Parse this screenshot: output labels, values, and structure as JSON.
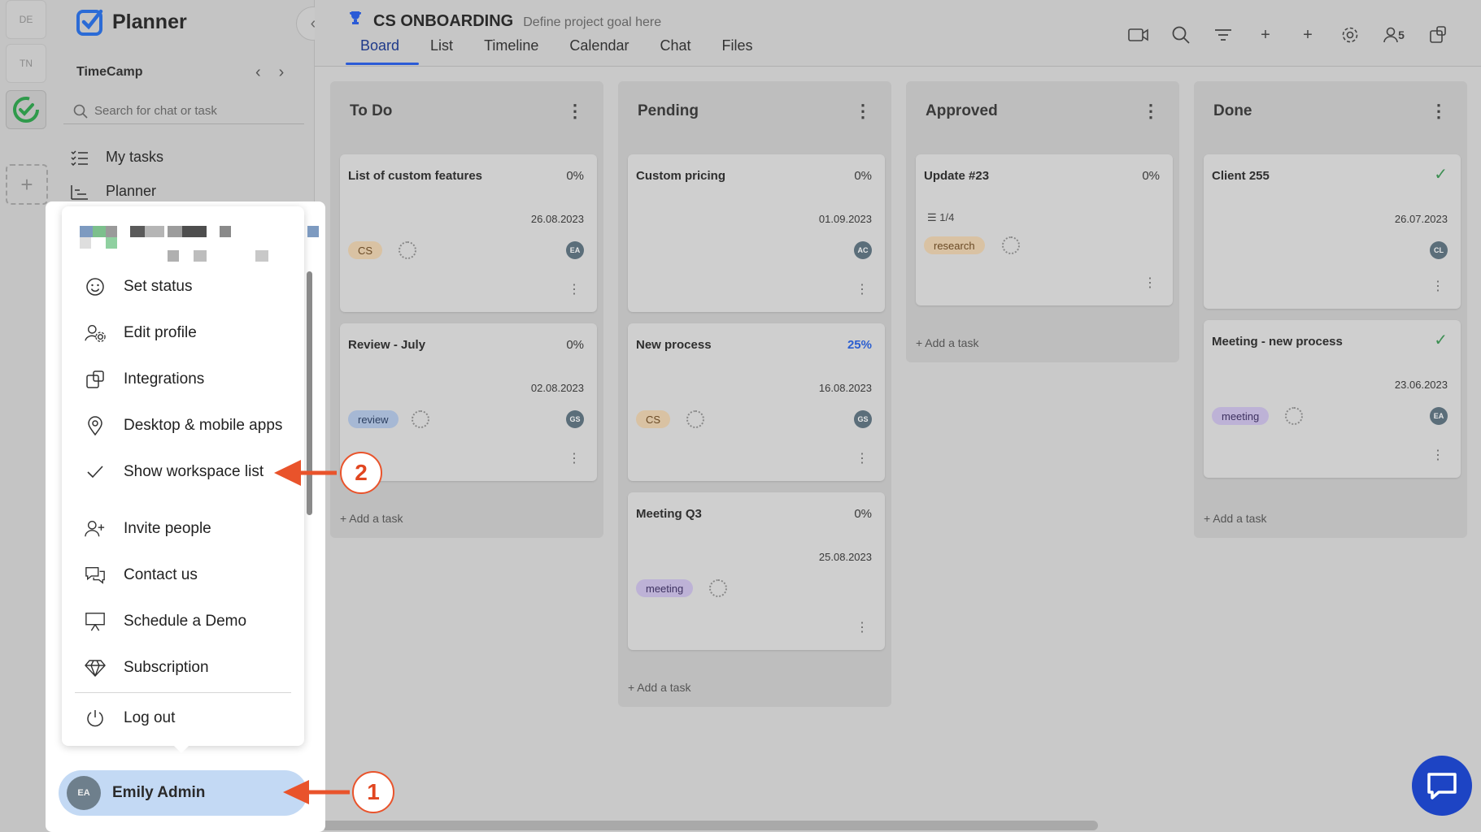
{
  "workspaces": [
    "DE",
    "TN"
  ],
  "app": {
    "name": "Planner"
  },
  "organization": {
    "name": "TimeCamp"
  },
  "search": {
    "placeholder": "Search for chat or task"
  },
  "nav": [
    {
      "label": "My tasks"
    },
    {
      "label": "Planner"
    }
  ],
  "project": {
    "name": "CS ONBOARDING",
    "goal_placeholder": "Define project goal here"
  },
  "tabs": [
    "Board",
    "List",
    "Timeline",
    "Calendar",
    "Chat",
    "Files"
  ],
  "active_tab": "Board",
  "members_count": "5",
  "colors": {
    "accent": "#2b5bd6",
    "annotation": "#e9532b",
    "done_check": "#3d8f53"
  },
  "columns": [
    {
      "title": "To Do",
      "add_label": "Add a task",
      "cards": [
        {
          "title": "List of custom features",
          "progress": "0%",
          "date": "26.08.2023",
          "tag": "CS",
          "assignee": "EA"
        },
        {
          "title": "Review - July",
          "progress": "0%",
          "date": "02.08.2023",
          "tag": "review",
          "assignee": "GS"
        }
      ]
    },
    {
      "title": "Pending",
      "add_label": "Add a task",
      "cards": [
        {
          "title": "Custom pricing",
          "progress": "0%",
          "date": "01.09.2023",
          "assignee": "AC"
        },
        {
          "title": "New process",
          "progress": "25%",
          "date": "16.08.2023",
          "tag": "CS",
          "assignee": "GS"
        },
        {
          "title": "Meeting Q3",
          "progress": "0%",
          "date": "25.08.2023",
          "tag": "meeting"
        }
      ]
    },
    {
      "title": "Approved",
      "add_label": "Add a task",
      "cards": [
        {
          "title": "Update #23",
          "progress": "0%",
          "subtasks": "1/4",
          "tag": "research"
        }
      ]
    },
    {
      "title": "Done",
      "add_label": "Add a task",
      "cards": [
        {
          "title": "Client 255",
          "date": "26.07.2023",
          "assignee": "CL"
        },
        {
          "title": "Meeting - new process",
          "date": "23.06.2023",
          "tag": "meeting",
          "assignee": "EA"
        }
      ]
    }
  ],
  "profile_menu": {
    "items": [
      {
        "label": "Set status",
        "icon": "smiley-icon"
      },
      {
        "label": "Edit profile",
        "icon": "user-gear-icon"
      },
      {
        "label": "Integrations",
        "icon": "puzzle-icon"
      },
      {
        "label": "Desktop & mobile apps",
        "icon": "location-pin-icon"
      },
      {
        "label": "Show workspace list",
        "icon": "check-icon"
      },
      {
        "label": "Invite people",
        "icon": "user-plus-icon"
      },
      {
        "label": "Contact us",
        "icon": "chat-bubbles-icon"
      },
      {
        "label": "Schedule a Demo",
        "icon": "presentation-icon"
      },
      {
        "label": "Subscription",
        "icon": "diamond-icon"
      },
      {
        "label": "Log out",
        "icon": "power-icon"
      }
    ]
  },
  "user": {
    "initials": "EA",
    "name": "Emily Admin"
  },
  "annotations": [
    {
      "label": "1"
    },
    {
      "label": "2"
    }
  ]
}
